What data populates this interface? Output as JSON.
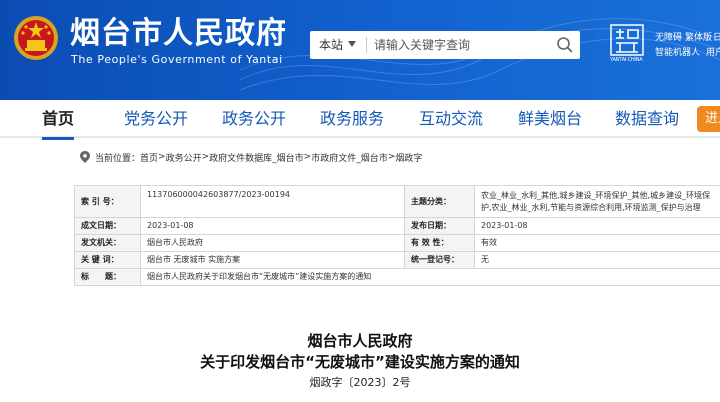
{
  "header": {
    "title": "烟台市人民政府",
    "subtitle": "The People's Government of Yantai",
    "search": {
      "scope": "本站",
      "placeholder": "请输入关键字查询"
    },
    "logo_text": "YANTAI·CHINA",
    "links": [
      "无障碍",
      "繁体版",
      "日",
      "智能机器人",
      "用户"
    ]
  },
  "nav": {
    "items": [
      "首页",
      "党务公开",
      "政务公开",
      "政务服务",
      "互动交流",
      "鲜美烟台",
      "数据查询"
    ],
    "special": "进入"
  },
  "breadcrumb": {
    "prefix": "当前位置：",
    "items": [
      "首页",
      "政务公开",
      "政府文件数据库_烟台市",
      "市政府文件_烟台市",
      "烟政字"
    ],
    "separator": " > "
  },
  "meta": {
    "index_label": "索 引 号：",
    "index_value": "11370600004260387​7/2023-00194",
    "topic_label": "主题分类：",
    "topic_value": "农业_林业_水利_其他,城乡建设_环境保护_其他,城乡建设_环境保护,农业_林业_水利,节能与资源综合利用,环境监测_保护与治理",
    "created_label": "成文日期：",
    "created_value": "2023-01-08",
    "published_label": "发布日期：",
    "published_value": "2023-01-08",
    "issuer_label": "发文机关：",
    "issuer_value": "烟台市人民政府",
    "validity_label": "有 效 性：",
    "validity_value": "有效",
    "keywords_label": "关 键 词：",
    "keywords_value": "烟台市 无废城市 实施方案",
    "unified_label": "统一登记号：",
    "unified_value": "无",
    "subject_label": "标　　题：",
    "subject_value": "烟台市人民政府关于印发烟台市“无废城市”建设实施方案的通知"
  },
  "document": {
    "issuer": "烟台市人民政府",
    "title": "关于印发烟台市“无废城市”建设实施方案的通知",
    "number": "烟政字〔2023〕2号"
  },
  "colors": {
    "primary": "#1558b8",
    "accent": "#f08a20",
    "header_bg": "#0b4cb3"
  }
}
